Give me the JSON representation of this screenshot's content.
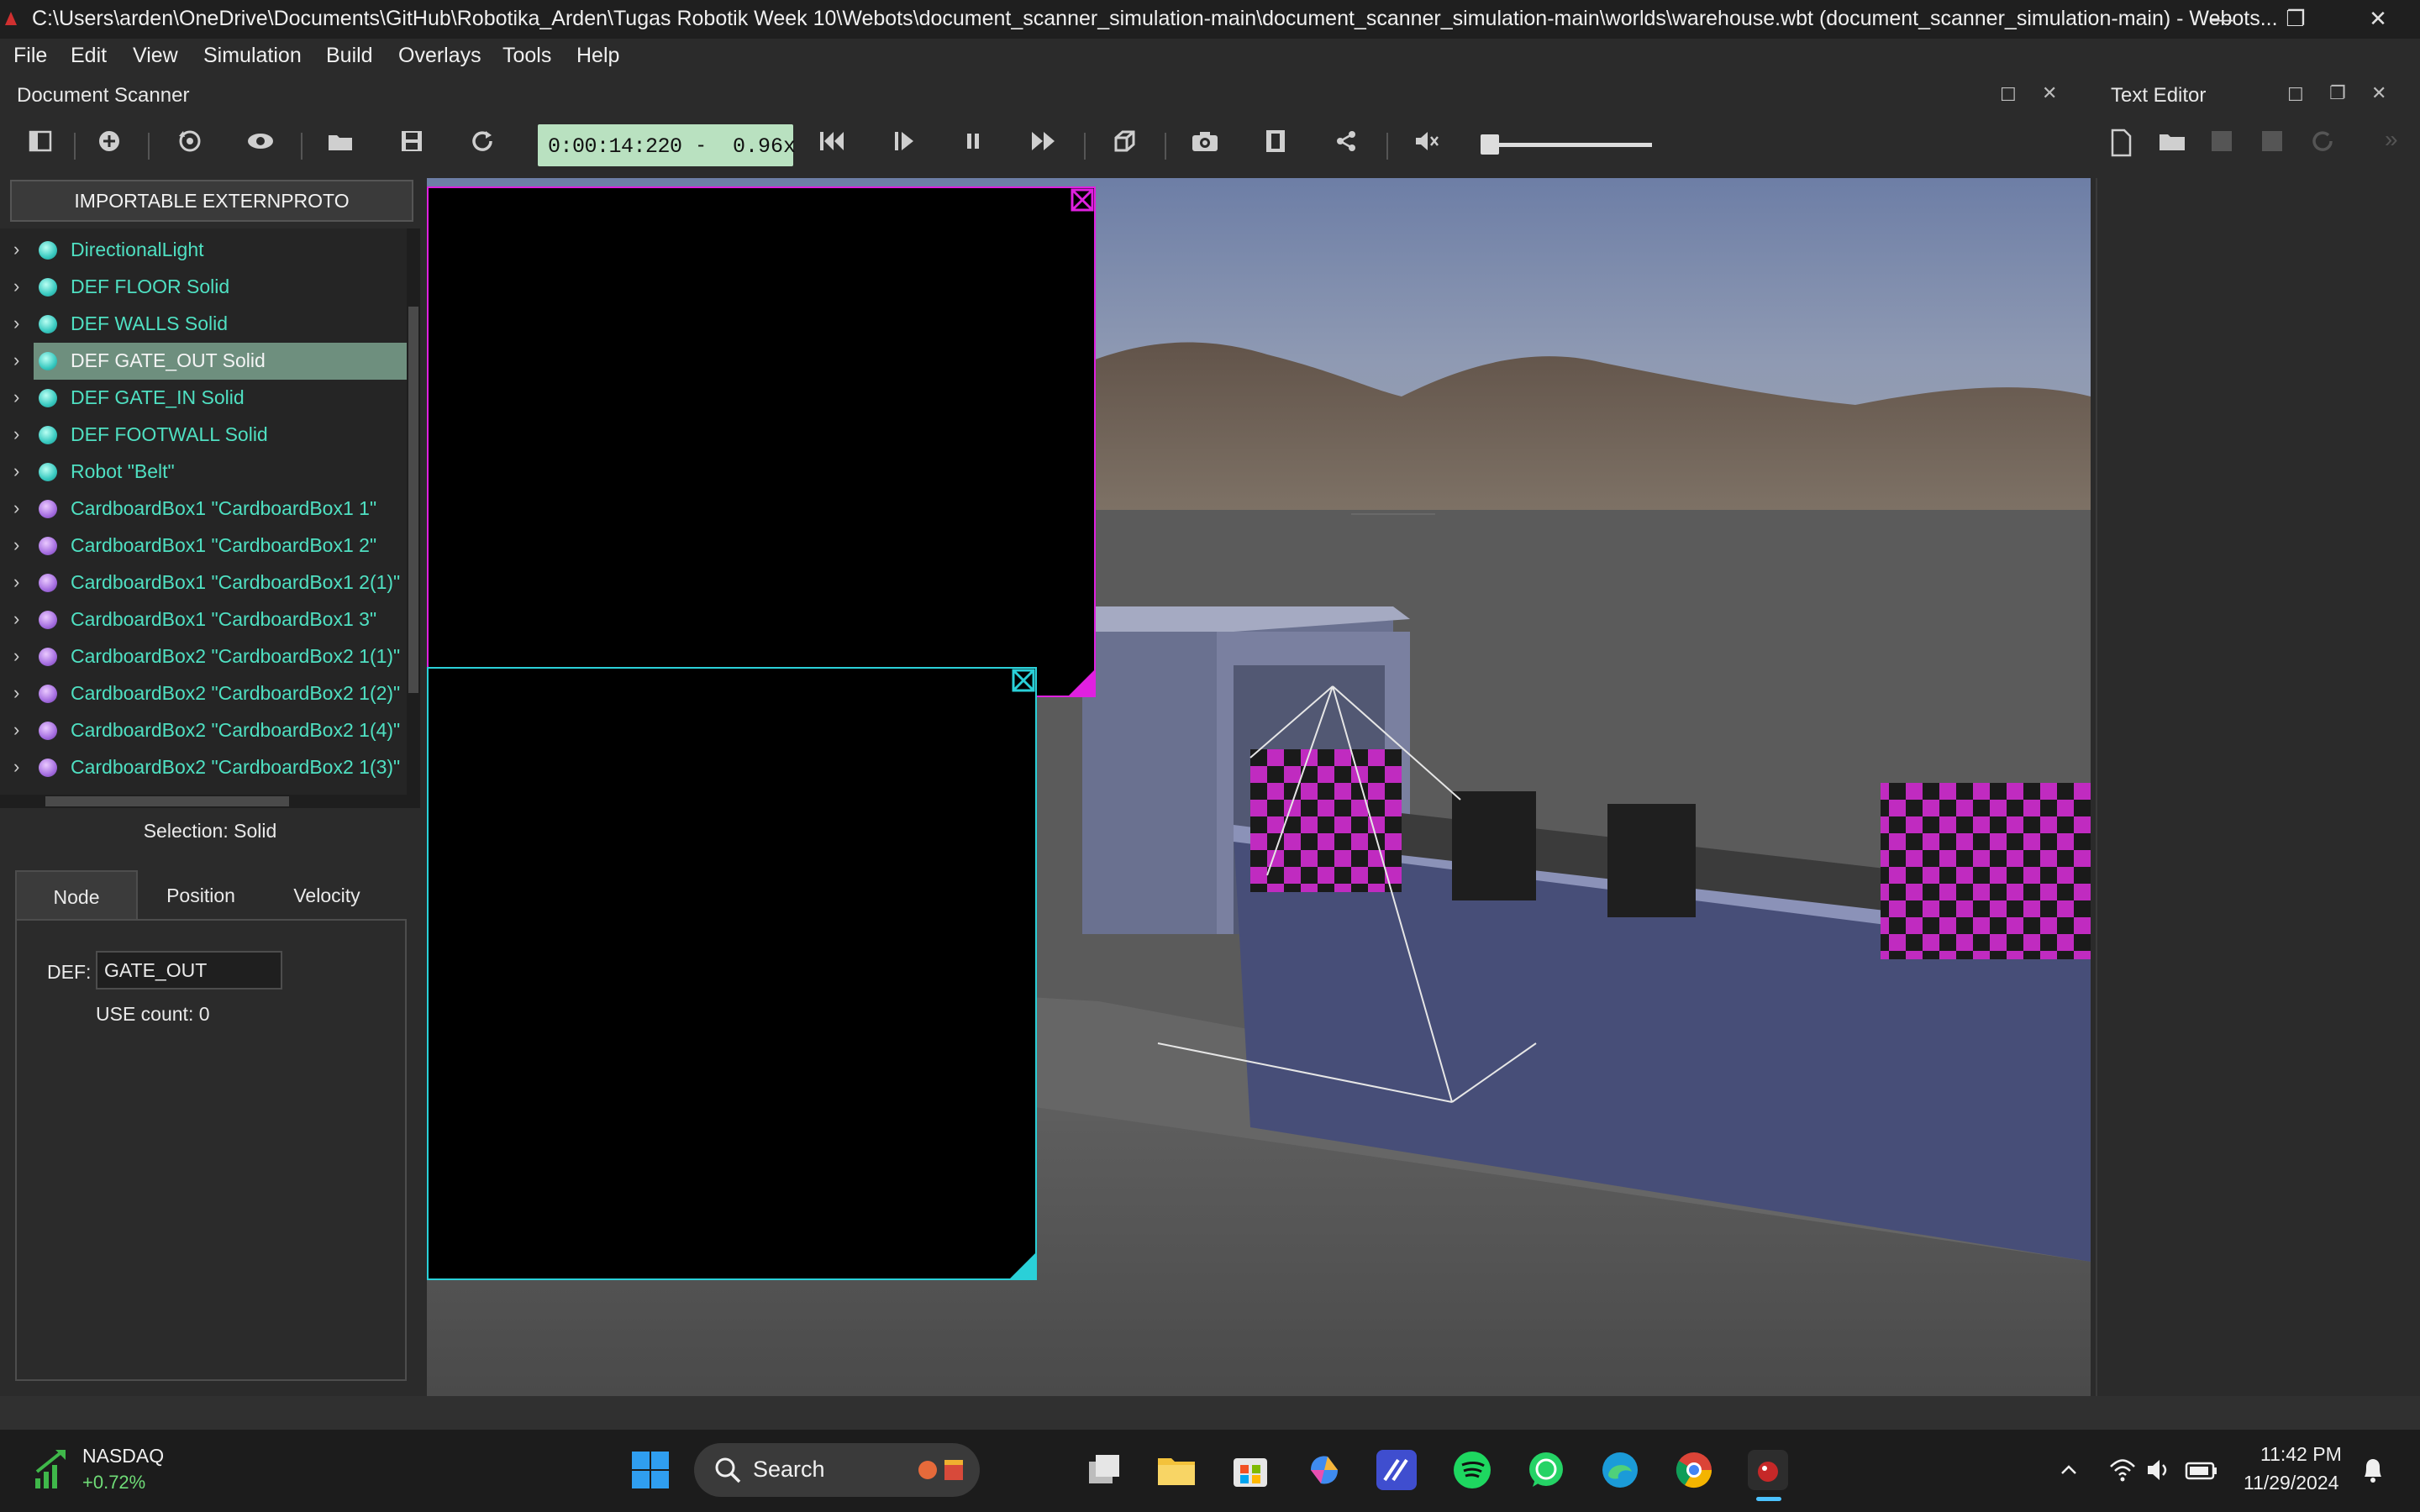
{
  "window": {
    "title": "C:\\Users\\arden\\OneDrive\\Documents\\GitHub\\Robotika_Arden\\Tugas Robotik Week 10\\Webots\\document_scanner_simulation-main\\document_scanner_simulation-main\\worlds\\warehouse.wbt (document_scanner_simulation-main) - Webots...",
    "controls": {
      "minimize": "—",
      "restore": "❐",
      "close": "✕"
    }
  },
  "menu": [
    "File",
    "Edit",
    "View",
    "Simulation",
    "Build",
    "Overlays",
    "Tools",
    "Help"
  ],
  "dock": {
    "title": "Document Scanner",
    "float_icon": "☐",
    "close_icon": "✕"
  },
  "text_editor": {
    "title": "Text Editor",
    "float_icon": "☐",
    "restore_icon": "❐",
    "close_icon": "✕"
  },
  "toolbar": {
    "time": "0:00:14:220",
    "speed_separator": "-",
    "speed": "0.96x",
    "icons": [
      "toggle-panel-icon",
      "add-node-icon",
      "reset-view-icon",
      "view-icon",
      "open-world-icon",
      "save-world-icon",
      "reload-world-icon",
      "reset-simulation-icon",
      "step-icon",
      "pause-icon",
      "fast-forward-icon",
      "3d-view-icon",
      "screenshot-icon",
      "movie-icon",
      "share-icon",
      "mute-icon"
    ]
  },
  "scene_tree": {
    "extern_button": "IMPORTABLE EXTERNPROTO",
    "items": [
      {
        "label": "DirectionalLight",
        "color": "cyan"
      },
      {
        "label": "DEF FLOOR Solid",
        "color": "cyan"
      },
      {
        "label": "DEF WALLS Solid",
        "color": "cyan"
      },
      {
        "label": "DEF GATE_OUT Solid",
        "color": "cyan",
        "selected": true
      },
      {
        "label": "DEF GATE_IN Solid",
        "color": "cyan"
      },
      {
        "label": "DEF FOOTWALL Solid",
        "color": "cyan"
      },
      {
        "label": "Robot \"Belt\"",
        "color": "cyan"
      },
      {
        "label": "CardboardBox1 \"CardboardBox1 1\"",
        "color": "purple"
      },
      {
        "label": "CardboardBox1 \"CardboardBox1 2\"",
        "color": "purple"
      },
      {
        "label": "CardboardBox1 \"CardboardBox1 2(1)\"",
        "color": "purple"
      },
      {
        "label": "CardboardBox1 \"CardboardBox1 3\"",
        "color": "purple"
      },
      {
        "label": "CardboardBox2 \"CardboardBox2 1(1)\"",
        "color": "purple"
      },
      {
        "label": "CardboardBox2 \"CardboardBox2 1(2)\"",
        "color": "purple"
      },
      {
        "label": "CardboardBox2 \"CardboardBox2 1(4)\"",
        "color": "purple"
      },
      {
        "label": "CardboardBox2 \"CardboardBox2 1(3)\"",
        "color": "purple"
      }
    ]
  },
  "field_editor": {
    "selection": "Selection: Solid",
    "tabs": [
      "Node",
      "Position",
      "Velocity"
    ],
    "active_tab": "Node",
    "def_label": "DEF:",
    "def_value": "GATE_OUT",
    "use_count": "USE count: 0"
  },
  "taskbar": {
    "stock": {
      "name": "NASDAQ",
      "change": "+0.72%"
    },
    "search_placeholder": "Search",
    "time": "11:42 PM",
    "date": "11/29/2024",
    "apps": [
      "windows-start-icon",
      "task-view-icon",
      "file-explorer-icon",
      "microsoft-store-icon",
      "copilot-icon",
      "vscode-icon",
      "spotify-icon",
      "whatsapp-icon",
      "edge-icon",
      "chrome-icon",
      "webots-icon"
    ]
  },
  "colors": {
    "selected_row": "#6e8f7e",
    "node_text": "#4fe0c2",
    "time_box": "#b9e1c0",
    "overlay_magenta": "#e020e0",
    "overlay_cyan": "#2ad0d8"
  }
}
